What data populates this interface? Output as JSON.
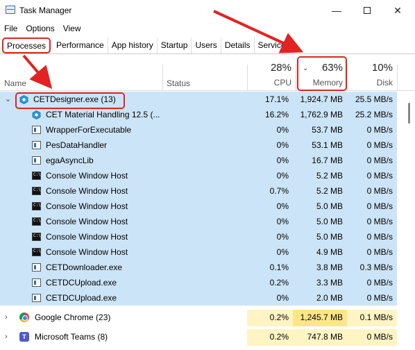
{
  "window": {
    "title": "Task Manager"
  },
  "menu": [
    "File",
    "Options",
    "View"
  ],
  "tabs": [
    "Processes",
    "Performance",
    "App history",
    "Startup",
    "Users",
    "Details",
    "Services"
  ],
  "header": {
    "name": "Name",
    "status": "Status",
    "cpu_pct": "28%",
    "cpu_label": "CPU",
    "mem_pct": "63%",
    "mem_label": "Memory",
    "disk_pct": "10%",
    "disk_label": "Disk"
  },
  "processes": [
    {
      "name": "CETDesigner.exe (13)",
      "cpu": "17.1%",
      "mem": "1,924.7 MB",
      "disk": "25.5 MB/s",
      "icon": "cet-icon"
    },
    {
      "name": "CET Material Handling 12.5 (...",
      "cpu": "16.2%",
      "mem": "1,762.9 MB",
      "disk": "25.2 MB/s",
      "icon": "cet-icon"
    },
    {
      "name": "WrapperForExecutable",
      "cpu": "0%",
      "mem": "53.7 MB",
      "disk": "0 MB/s",
      "icon": "exe-icon"
    },
    {
      "name": "PesDataHandler",
      "cpu": "0%",
      "mem": "53.1 MB",
      "disk": "0 MB/s",
      "icon": "exe-icon"
    },
    {
      "name": "egaAsyncLib",
      "cpu": "0%",
      "mem": "16.7 MB",
      "disk": "0 MB/s",
      "icon": "exe-icon"
    },
    {
      "name": "Console Window Host",
      "cpu": "0%",
      "mem": "5.2 MB",
      "disk": "0 MB/s",
      "icon": "console-icon"
    },
    {
      "name": "Console Window Host",
      "cpu": "0.7%",
      "mem": "5.2 MB",
      "disk": "0 MB/s",
      "icon": "console-icon"
    },
    {
      "name": "Console Window Host",
      "cpu": "0%",
      "mem": "5.0 MB",
      "disk": "0 MB/s",
      "icon": "console-icon"
    },
    {
      "name": "Console Window Host",
      "cpu": "0%",
      "mem": "5.0 MB",
      "disk": "0 MB/s",
      "icon": "console-icon"
    },
    {
      "name": "Console Window Host",
      "cpu": "0%",
      "mem": "5.0 MB",
      "disk": "0 MB/s",
      "icon": "console-icon"
    },
    {
      "name": "Console Window Host",
      "cpu": "0%",
      "mem": "4.9 MB",
      "disk": "0 MB/s",
      "icon": "console-icon"
    },
    {
      "name": "CETDownloader.exe",
      "cpu": "0.1%",
      "mem": "3.8 MB",
      "disk": "0.3 MB/s",
      "icon": "exe-icon"
    },
    {
      "name": "CETDCUpload.exe",
      "cpu": "0.2%",
      "mem": "3.3 MB",
      "disk": "0 MB/s",
      "icon": "exe-icon"
    },
    {
      "name": "CETDCUpload.exe",
      "cpu": "0%",
      "mem": "2.0 MB",
      "disk": "0 MB/s",
      "icon": "exe-icon"
    },
    {
      "name": "Google Chrome (23)",
      "cpu": "0.2%",
      "mem": "1,245.7 MB",
      "disk": "0.1 MB/s",
      "icon": "chrome-icon"
    },
    {
      "name": "Microsoft Teams (8)",
      "cpu": "0.2%",
      "mem": "747.8 MB",
      "disk": "0 MB/s",
      "icon": "teams-icon"
    }
  ],
  "colors": {
    "selection": "#cce4f7",
    "heat_light": "#fff4c4",
    "heat_mid": "#fde68a",
    "annotation": "#e32222"
  }
}
